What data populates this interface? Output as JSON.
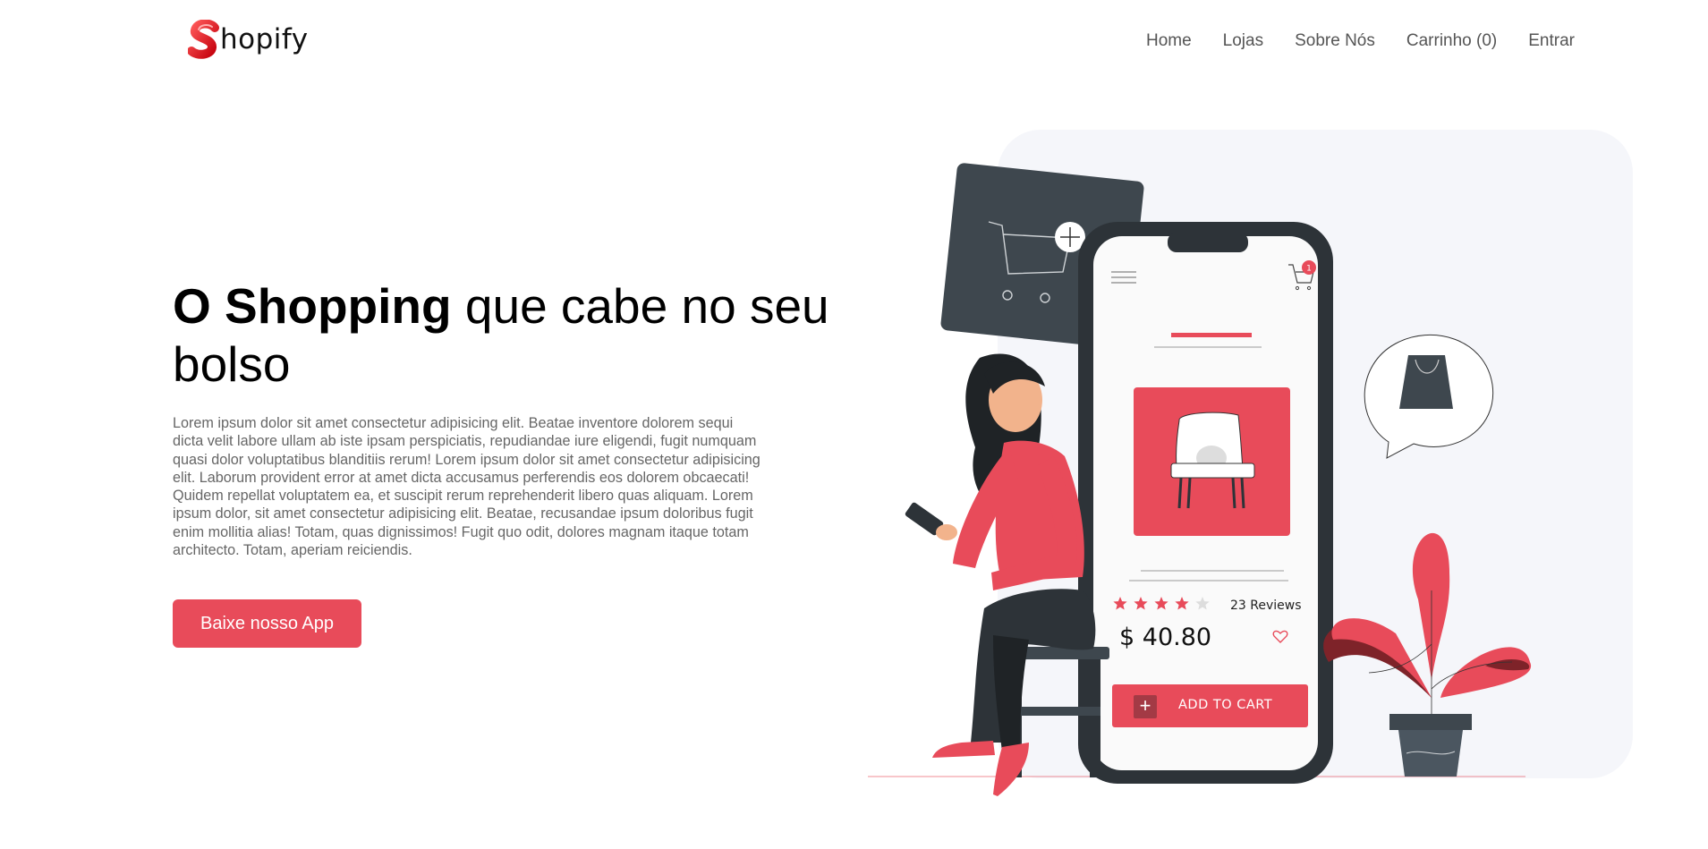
{
  "brand": {
    "name_rest": "hopify",
    "accent": "#e84b5a"
  },
  "nav": [
    {
      "label": "Home"
    },
    {
      "label": "Lojas"
    },
    {
      "label": "Sobre Nós"
    },
    {
      "label": "Carrinho (0)"
    },
    {
      "label": "Entrar"
    }
  ],
  "hero": {
    "title_bold": "O Shopping",
    "title_rest": " que cabe no seu bolso",
    "paragraph": "Lorem ipsum dolor sit amet consectetur adipisicing elit. Beatae inventore dolorem sequi dicta velit labore ullam ab iste ipsam perspiciatis, repudiandae iure eligendi, fugit numquam quasi dolor voluptatibus blanditiis rerum! Lorem ipsum dolor sit amet consectetur adipisicing elit. Laborum provident error at amet dicta accusamus perferendis eos dolorem obcaecati! Quidem repellat voluptatem ea, et suscipit rerum reprehenderit libero quas aliquam. Lorem ipsum dolor, sit amet consectetur adipisicing elit. Beatae, recusandae ipsum doloribus fugit enim mollitia alias! Totam, quas dignissimos! Fugit quo odit, dolores magnam itaque totam architecto. Totam, aperiam reiciendis.",
    "cta_label": "Baixe nosso App"
  },
  "illustration": {
    "cart_badge": "1",
    "rating_stars": 4,
    "rating_max": 5,
    "reviews": "23 Reviews",
    "price": "$ 40.80",
    "add_to_cart": "ADD TO CART"
  }
}
